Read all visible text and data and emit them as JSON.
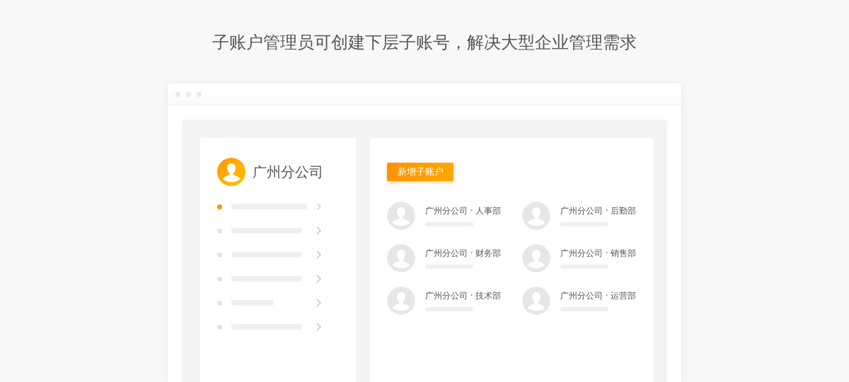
{
  "headline": "子账户管理员可创建下层子账号，解决大型企业管理需求",
  "company": {
    "name": "广州分公司"
  },
  "menu_items": [
    {
      "selected": true
    },
    {
      "selected": false
    },
    {
      "selected": false
    },
    {
      "selected": false
    },
    {
      "selected": false
    },
    {
      "selected": false
    }
  ],
  "add_button": "新增子账户",
  "accounts": [
    {
      "name": "广州分公司 · 人事部"
    },
    {
      "name": "广州分公司 · 后勤部"
    },
    {
      "name": "广州分公司 · 财务部"
    },
    {
      "name": "广州分公司 · 销售部"
    },
    {
      "name": "广州分公司 · 技术部"
    },
    {
      "name": "广州分公司 · 运营部"
    }
  ]
}
